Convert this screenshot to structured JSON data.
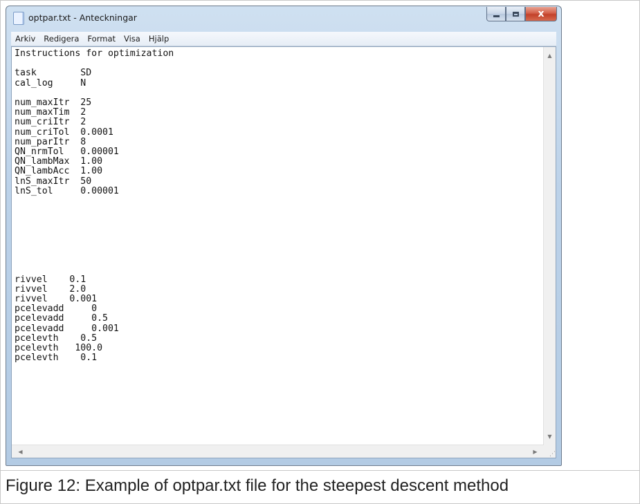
{
  "window": {
    "title": "optpar.txt - Anteckningar",
    "close_glyph": "x"
  },
  "menu": [
    "Arkiv",
    "Redigera",
    "Format",
    "Visa",
    "Hjälp"
  ],
  "editor": {
    "lines": [
      "Instructions for optimization",
      "",
      "task        SD",
      "cal_log     N",
      "",
      "num_maxItr  25",
      "num_maxTim  2",
      "num_criItr  2",
      "num_criTol  0.0001",
      "num_parItr  8",
      "QN_nrmTol   0.00001",
      "QN_lambMax  1.00",
      "QN_lambAcc  1.00",
      "lnS_maxItr  50",
      "lnS_tol     0.00001",
      "",
      "",
      "",
      "",
      "",
      "",
      "",
      "",
      "rivvel    0.1",
      "rivvel    2.0",
      "rivvel    0.001",
      "pcelevadd     0",
      "pcelevadd     0.5",
      "pcelevadd     0.001",
      "pcelevth    0.5",
      "pcelevth   100.0",
      "pcelevth    0.1"
    ]
  },
  "icons": {
    "app": "notepad-icon",
    "minimize": "minimize-icon",
    "maximize": "maximize-icon",
    "close": "close-icon"
  },
  "figure_caption": "Figure 12: Example of optpar.txt file for the steepest descent method"
}
